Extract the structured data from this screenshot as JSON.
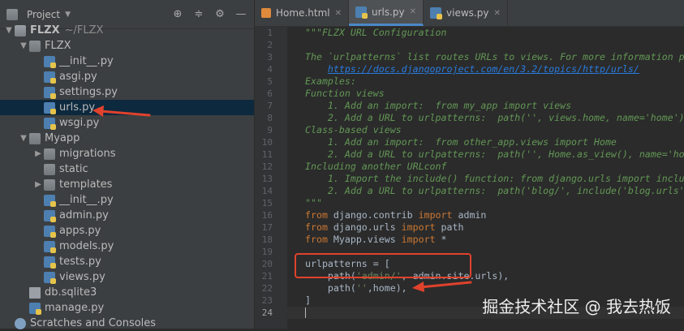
{
  "sidebar": {
    "title": "Project",
    "tree": [
      {
        "label": "FLZX",
        "sub": "~/FLZX",
        "type": "root",
        "indent": 0,
        "arrow": "open"
      },
      {
        "label": "FLZX",
        "type": "folder",
        "indent": 1,
        "arrow": "open"
      },
      {
        "label": "__init__.py",
        "type": "py",
        "indent": 2
      },
      {
        "label": "asgi.py",
        "type": "py",
        "indent": 2
      },
      {
        "label": "settings.py",
        "type": "py",
        "indent": 2
      },
      {
        "label": "urls.py",
        "type": "py",
        "indent": 2,
        "selected": true
      },
      {
        "label": "wsgi.py",
        "type": "py",
        "indent": 2
      },
      {
        "label": "Myapp",
        "type": "folder",
        "indent": 1,
        "arrow": "open"
      },
      {
        "label": "migrations",
        "type": "folder",
        "indent": 2,
        "arrow": "closed"
      },
      {
        "label": "static",
        "type": "folder",
        "indent": 2
      },
      {
        "label": "templates",
        "type": "folder",
        "indent": 2,
        "arrow": "closed"
      },
      {
        "label": "__init__.py",
        "type": "py",
        "indent": 2
      },
      {
        "label": "admin.py",
        "type": "py",
        "indent": 2
      },
      {
        "label": "apps.py",
        "type": "py",
        "indent": 2
      },
      {
        "label": "models.py",
        "type": "py",
        "indent": 2
      },
      {
        "label": "tests.py",
        "type": "py",
        "indent": 2
      },
      {
        "label": "views.py",
        "type": "py",
        "indent": 2
      },
      {
        "label": "db.sqlite3",
        "type": "db",
        "indent": 1
      },
      {
        "label": "manage.py",
        "type": "py",
        "indent": 1
      },
      {
        "label": "Scratches and Consoles",
        "type": "scratch",
        "indent": 0
      }
    ]
  },
  "tabs": [
    {
      "label": "Home.html",
      "icon": "html-file-icon",
      "active": false
    },
    {
      "label": "urls.py",
      "icon": "python-file-icon",
      "active": true
    },
    {
      "label": "views.py",
      "icon": "python-file-icon",
      "active": false
    }
  ],
  "code": {
    "current_line": 24,
    "lines": [
      [
        {
          "t": "\"\"\"FLZX URL Configuration",
          "c": "doc"
        }
      ],
      [],
      [
        {
          "t": "The `urlpatterns` list routes URLs to views. For more information p",
          "c": "doc"
        }
      ],
      [
        {
          "t": "    ",
          "c": "doc"
        },
        {
          "t": "https://docs.djangoproject.com/en/3.2/topics/http/urls/",
          "c": "link"
        }
      ],
      [
        {
          "t": "Examples:",
          "c": "doc"
        }
      ],
      [
        {
          "t": "Function views",
          "c": "doc"
        }
      ],
      [
        {
          "t": "    1. Add an import:  from my_app import views",
          "c": "doc"
        }
      ],
      [
        {
          "t": "    2. Add a URL to urlpatterns:  path('', views.home, name='home')",
          "c": "doc"
        }
      ],
      [
        {
          "t": "Class-based views",
          "c": "doc"
        }
      ],
      [
        {
          "t": "    1. Add an import:  from other_app.views import Home",
          "c": "doc"
        }
      ],
      [
        {
          "t": "    2. Add a URL to urlpatterns:  path('', Home.as_view(), name='ho",
          "c": "doc"
        }
      ],
      [
        {
          "t": "Including another URLconf",
          "c": "doc"
        }
      ],
      [
        {
          "t": "    1. Import the include() function: from django.urls import inclu",
          "c": "doc"
        }
      ],
      [
        {
          "t": "    2. Add a URL to urlpatterns:  path('blog/', include('blog.urls'",
          "c": "doc"
        }
      ],
      [
        {
          "t": "\"\"\"",
          "c": "doc"
        }
      ],
      [
        {
          "t": "from",
          "c": "kw"
        },
        {
          "t": " django.contrib ",
          "c": ""
        },
        {
          "t": "import",
          "c": "kw"
        },
        {
          "t": " admin",
          "c": ""
        }
      ],
      [
        {
          "t": "from",
          "c": "kw"
        },
        {
          "t": " django.urls ",
          "c": ""
        },
        {
          "t": "import",
          "c": "kw"
        },
        {
          "t": " path",
          "c": ""
        }
      ],
      [
        {
          "t": "from",
          "c": "kw"
        },
        {
          "t": " Myapp.views ",
          "c": ""
        },
        {
          "t": "import",
          "c": "kw"
        },
        {
          "t": " *",
          "c": ""
        }
      ],
      [],
      [
        {
          "t": "urlpatterns = [",
          "c": ""
        }
      ],
      [
        {
          "t": "    path(",
          "c": ""
        },
        {
          "t": "'admin/'",
          "c": "str"
        },
        {
          "t": ", admin.site.urls),",
          "c": ""
        }
      ],
      [
        {
          "t": "    path(",
          "c": ""
        },
        {
          "t": "''",
          "c": "str"
        },
        {
          "t": ",home),",
          "c": ""
        }
      ],
      [
        {
          "t": "]",
          "c": ""
        }
      ],
      []
    ]
  },
  "watermark": "掘金技术社区 @ 我去热饭",
  "colors": {
    "highlight": "#e0422c",
    "selection": "#0d293e",
    "keyword": "#cc7832",
    "docstring": "#629755"
  }
}
